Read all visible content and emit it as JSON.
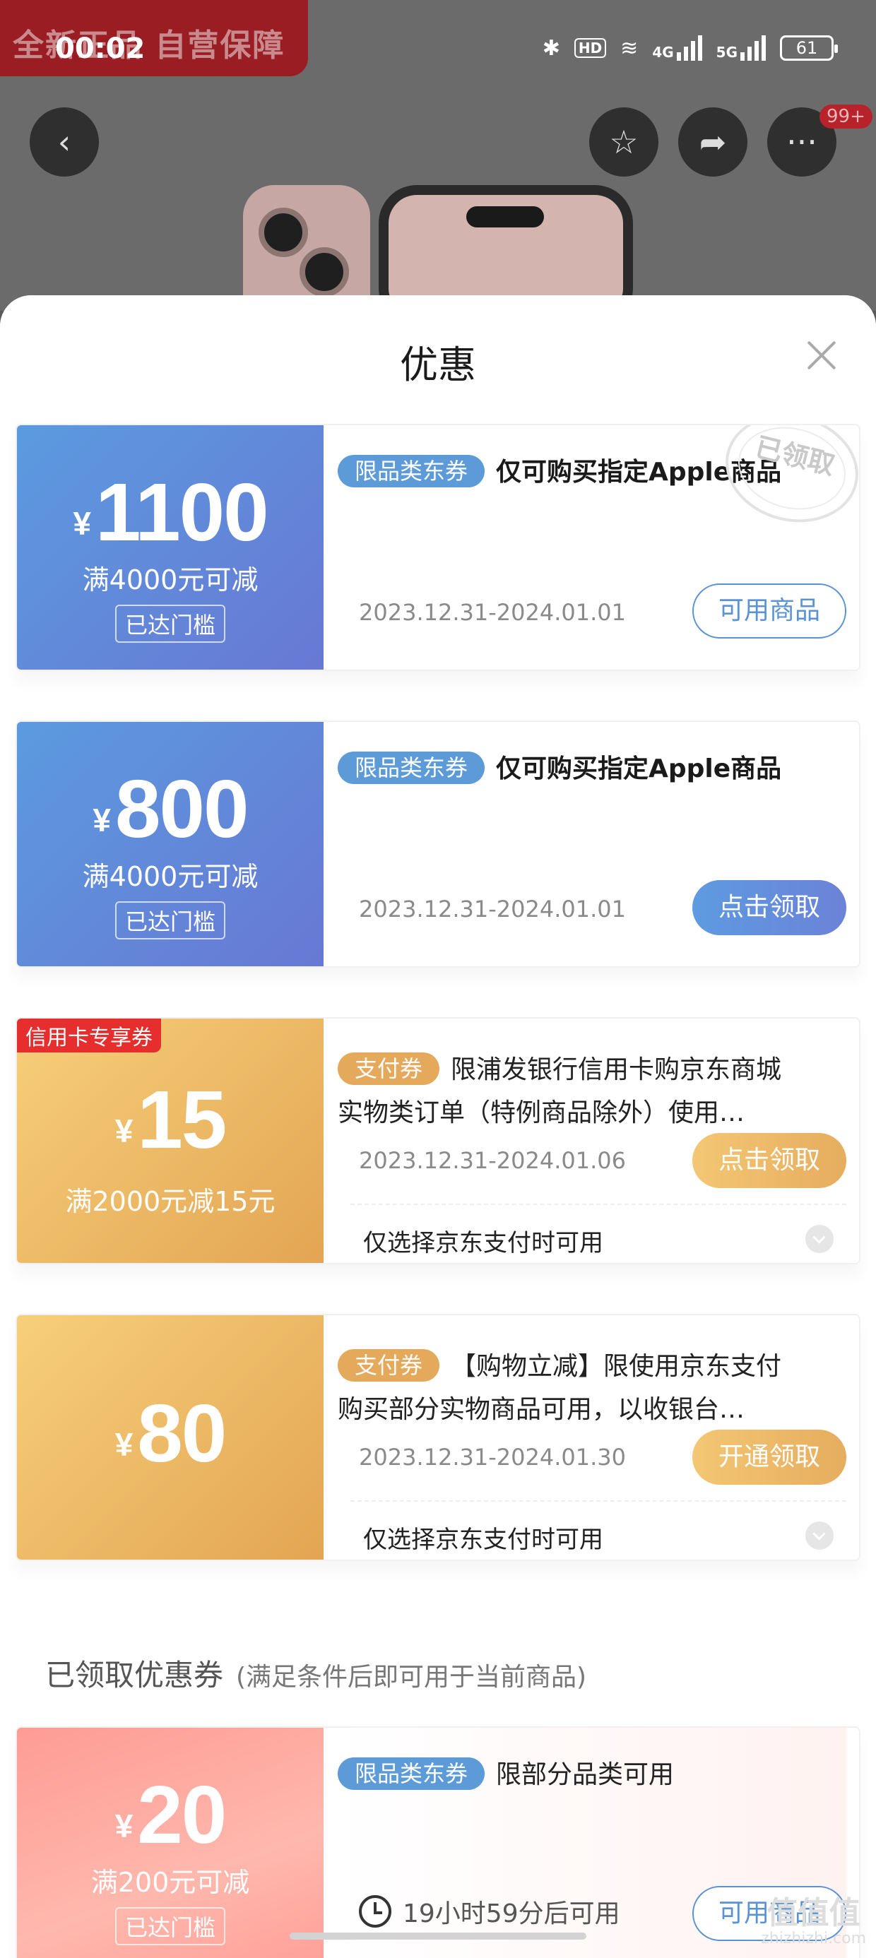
{
  "status_bar": {
    "time": "00:02",
    "battery": "61",
    "hd": "HD",
    "net1": "4G",
    "net2": "5G"
  },
  "background": {
    "promo_text": "全新正品 自营保障",
    "cart_badge": "99+"
  },
  "sheet": {
    "title": "优惠",
    "coupons": [
      {
        "currency": "¥",
        "amount": "1100",
        "condition": "满4000元可减",
        "threshold": "已达门槛",
        "tag": "限品类东券",
        "desc": "仅可购买指定Apple商品",
        "date": "2023.12.31-2024.01.01",
        "button": "可用商品",
        "stamp": "已领取"
      },
      {
        "currency": "¥",
        "amount": "800",
        "condition": "满4000元可减",
        "threshold": "已达门槛",
        "tag": "限品类东券",
        "desc": "仅可购买指定Apple商品",
        "date": "2023.12.31-2024.01.01",
        "button": "点击领取"
      },
      {
        "corner_tag": "信用卡专享券",
        "currency": "¥",
        "amount": "15",
        "condition": "满2000元减15元",
        "tag": "支付券",
        "desc": "限浦发银行信用卡购京东商城",
        "desc2": "实物类订单（特例商品除外）使用，仅...",
        "date": "2023.12.31-2024.01.06",
        "button": "点击领取",
        "note": "仅选择京东支付时可用"
      },
      {
        "currency": "¥",
        "amount": "80",
        "tag": "支付券",
        "desc": "【购物立减】限使用京东支付",
        "desc2": "购买部分实物商品可用，以收银台结算...",
        "date": "2023.12.31-2024.01.30",
        "button": "开通领取",
        "note": "仅选择京东支付时可用"
      }
    ],
    "received_section": {
      "title": "已领取优惠券",
      "subtitle": "(满足条件后即可用于当前商品)"
    },
    "received_coupon": {
      "currency": "¥",
      "amount": "20",
      "condition": "满200元可减",
      "threshold": "已达门槛",
      "tag": "限品类东券",
      "desc": "限部分品类可用",
      "countdown": "19小时59分后可用",
      "button": "可用商品"
    }
  },
  "watermark": {
    "text": "值值值",
    "sub": "zhizhizhi.com"
  },
  "colors": {
    "blue_stub": "#5b9bdf",
    "gold_stub": "#e3a553",
    "pink_stub": "#fe9c94",
    "accent_blue": "#5a93d4",
    "credit_red": "#e62e2e"
  }
}
